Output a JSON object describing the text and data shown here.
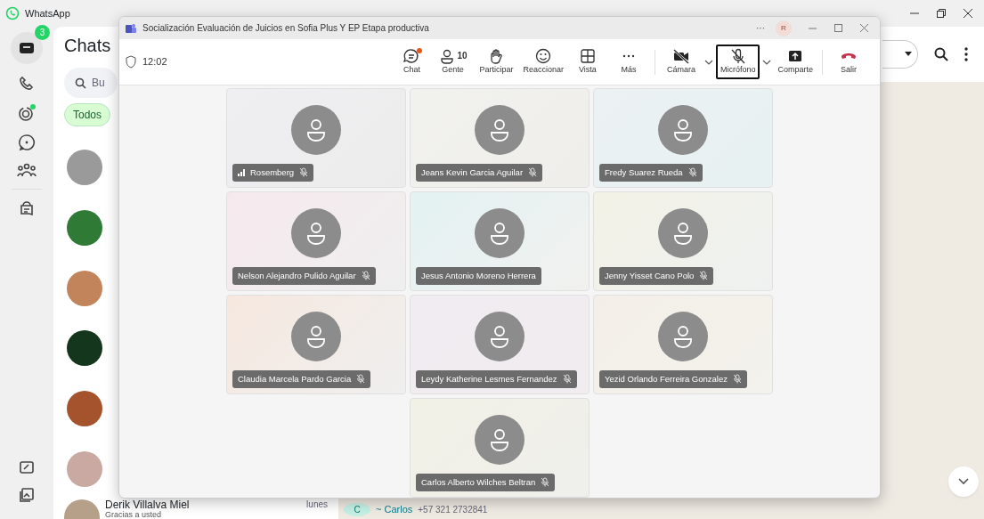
{
  "whatsapp": {
    "title": "WhatsApp",
    "unread_badge": "3",
    "header": "Chats",
    "search": {
      "placeholder": "Bu"
    },
    "filters": [
      {
        "label": "Todos",
        "selected": true
      }
    ],
    "chats": [
      {
        "name": "Derik Villalva Miel",
        "time": "lunes",
        "preview": "Gracias a usted"
      }
    ],
    "conversation": {
      "sender_initial": "C",
      "sender": "~ Carlos",
      "phone": "+57 321 2732841"
    }
  },
  "meeting": {
    "title": "Socialización Evaluación de Juicios en Sofia Plus Y EP Etapa productiva",
    "more": "···",
    "user_initial": "R",
    "timer": "12:02",
    "toolbar": [
      {
        "kind": "chat",
        "label": "Chat",
        "selected": false,
        "notify": true
      },
      {
        "kind": "people",
        "label": "Gente",
        "count": "10",
        "selected": false,
        "notify": false
      },
      {
        "kind": "hand",
        "label": "Participar",
        "selected": false,
        "notify": false
      },
      {
        "kind": "react",
        "label": "Reaccionar",
        "selected": false,
        "notify": false
      },
      {
        "kind": "view",
        "label": "Vista",
        "selected": false,
        "notify": false
      },
      {
        "kind": "more",
        "label": "Más",
        "selected": false,
        "notify": false
      },
      {
        "kind": "camera",
        "label": "Cámara",
        "selected": false,
        "notify": false
      },
      {
        "kind": "mic",
        "label": "Micrófono",
        "selected": true,
        "notify": false
      },
      {
        "kind": "share",
        "label": "Comparte",
        "selected": false,
        "notify": false
      },
      {
        "kind": "leave",
        "label": "Salir",
        "selected": false,
        "notify": false
      }
    ],
    "participants": [
      {
        "name": "Rosemberg",
        "muted": true,
        "signal": true
      },
      {
        "name": "Jeans Kevin Garcia Aguilar",
        "muted": true,
        "signal": false
      },
      {
        "name": "Fredy Suarez Rueda",
        "muted": true,
        "signal": false
      },
      {
        "name": "Nelson Alejandro Pulido Aguilar",
        "muted": true,
        "signal": false
      },
      {
        "name": "Jesus Antonio Moreno Herrera",
        "muted": false,
        "signal": false
      },
      {
        "name": "Jenny Yisset Cano Polo",
        "muted": true,
        "signal": false
      },
      {
        "name": "Claudia Marcela Pardo Garcia",
        "muted": true,
        "signal": false
      },
      {
        "name": "Leydy Katherine Lesmes Fernandez",
        "muted": true,
        "signal": false
      },
      {
        "name": "Yezid Orlando Ferreira Gonzalez",
        "muted": true,
        "signal": false
      },
      {
        "name": "Carlos Alberto Wilches Beltran",
        "muted": true,
        "signal": false
      }
    ]
  }
}
